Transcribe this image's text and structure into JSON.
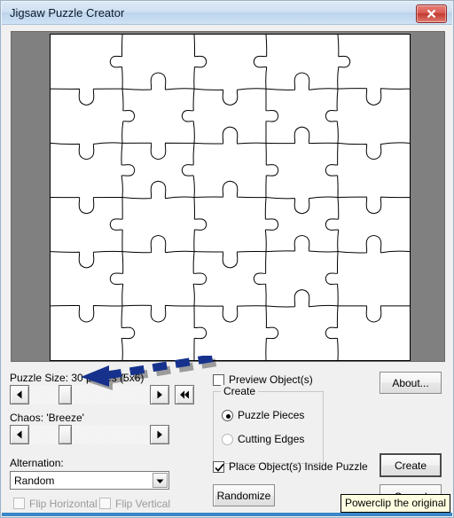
{
  "window": {
    "title": "Jigsaw Puzzle Creator",
    "close_icon": "close-x-icon"
  },
  "preview": {
    "grid_cols": 5,
    "grid_rows": 6,
    "piece_count": 30,
    "background_color": "#808080",
    "canvas_color": "#ffffff",
    "line_color": "#000000"
  },
  "controls": {
    "puzzle_size_label": "Puzzle Size: 30 pieces (5x6)",
    "chaos_label": "Chaos: 'Breeze'",
    "alternation_label": "Alternation:",
    "alternation_value": "Random",
    "alternation_options": [
      "Random"
    ],
    "flip_horizontal_label": "Flip Horizontal",
    "flip_horizontal_checked": false,
    "flip_horizontal_enabled": false,
    "flip_vertical_label": "Flip Vertical",
    "flip_vertical_checked": false,
    "flip_vertical_enabled": false,
    "size_slider": {
      "left_arrow_icon": "triangle-left-icon",
      "right_arrow_icon": "triangle-right-icon",
      "rewind_icon": "double-triangle-left-icon"
    },
    "chaos_slider": {
      "left_arrow_icon": "triangle-left-icon",
      "right_arrow_icon": "triangle-right-icon"
    }
  },
  "options": {
    "preview_objects_label": "Preview Object(s)",
    "preview_objects_checked": false,
    "create_group_title": "Create",
    "radio_puzzle_pieces_label": "Puzzle Pieces",
    "radio_puzzle_pieces_selected": true,
    "radio_cutting_edges_label": "Cutting Edges",
    "radio_cutting_edges_selected": false,
    "place_objects_label": "Place Object(s) Inside Puzzle",
    "place_objects_checked": true
  },
  "buttons": {
    "about": "About...",
    "create": "Create",
    "randomize": "Randomize",
    "cancel": "Cancel"
  },
  "tooltip": {
    "text": "Powerclip the original"
  },
  "annotation": {
    "type": "arrow",
    "color": "#16328c",
    "points_to": "puzzle-size-slider"
  }
}
